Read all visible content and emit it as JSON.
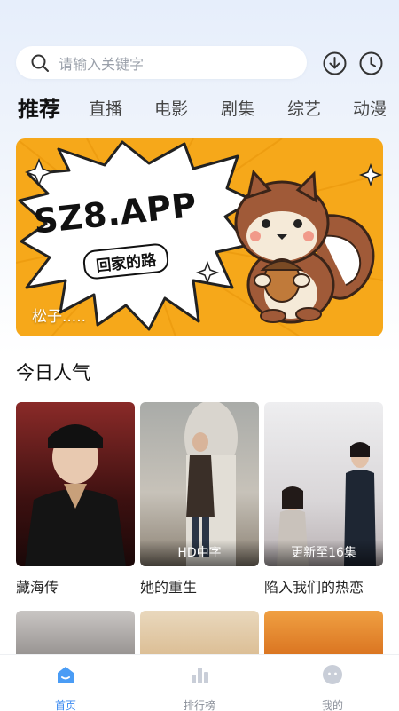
{
  "search": {
    "placeholder": "请输入关键字"
  },
  "tabs": [
    {
      "label": "推荐",
      "active": true
    },
    {
      "label": "直播"
    },
    {
      "label": "电影"
    },
    {
      "label": "剧集"
    },
    {
      "label": "综艺"
    },
    {
      "label": "动漫"
    }
  ],
  "banner": {
    "title": "SZ8.APP",
    "subtitle": "回家的路",
    "caption": "松子....."
  },
  "section": {
    "title": "今日人气"
  },
  "cards": [
    {
      "title": "藏海传",
      "badge": "",
      "poster_color": "#7a1f1f"
    },
    {
      "title": "她的重生",
      "badge": "HD中字",
      "poster_color": "#b9b5ad"
    },
    {
      "title": "陷入我们的热恋",
      "badge": "更新至16集",
      "poster_color": "#d8d6dc"
    }
  ],
  "bottom_nav": [
    {
      "label": "首页",
      "icon": "home-icon",
      "active": true
    },
    {
      "label": "排行榜",
      "icon": "chart-icon"
    },
    {
      "label": "我的",
      "icon": "profile-icon"
    }
  ],
  "colors": {
    "accent": "#3b8af0",
    "banner": "#f6a81a"
  }
}
